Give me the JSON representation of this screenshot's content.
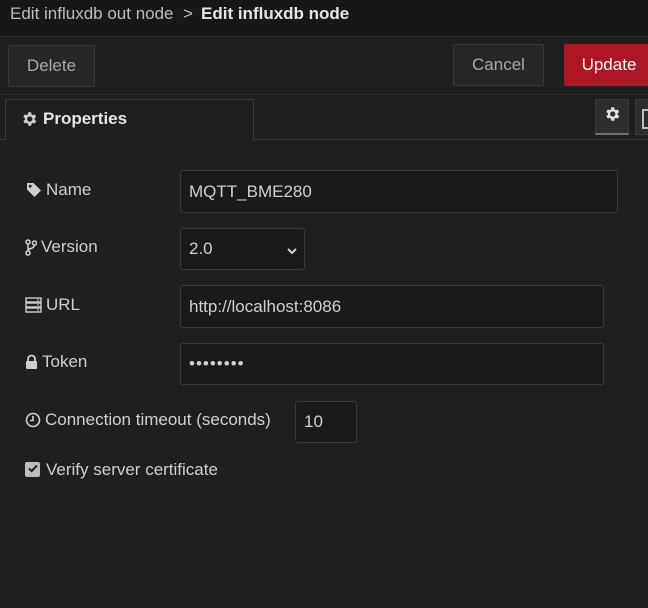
{
  "breadcrumb": {
    "previous": "Edit influxdb out node",
    "separator": ">",
    "current": "Edit influxdb node"
  },
  "toolbar": {
    "delete_label": "Delete",
    "cancel_label": "Cancel",
    "update_label": "Update"
  },
  "tabs": {
    "properties_label": "Properties"
  },
  "form": {
    "name": {
      "label": "Name",
      "value": "MQTT_BME280"
    },
    "version": {
      "label": "Version",
      "value": "2.0"
    },
    "url": {
      "label": "URL",
      "value": "http://localhost:8086"
    },
    "token": {
      "label": "Token",
      "value": "••••••••"
    },
    "timeout": {
      "label": "Connection timeout (seconds)",
      "value": "10"
    },
    "verify": {
      "label": "Verify server certificate",
      "checked": true
    }
  },
  "colors": {
    "update_button": "#ad1625",
    "background": "#1f1f1f"
  },
  "icons": [
    "gear-icon",
    "tag-icon",
    "branch-icon",
    "server-icon",
    "lock-icon",
    "clock-icon",
    "checkmark-icon"
  ]
}
